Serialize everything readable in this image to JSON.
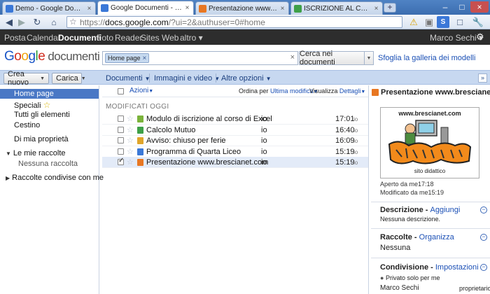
{
  "browser": {
    "tabs": [
      {
        "title": "Demo - Google Documenti",
        "favicon": "gdocs-icon",
        "active": false
      },
      {
        "title": "Google Documenti - Home ...",
        "favicon": "gdocs-icon",
        "active": true
      },
      {
        "title": "Presentazione www.bresci...",
        "favicon": "presentation-icon",
        "active": false
      },
      {
        "title": "ISCRIZIONE AL CORSO DI ...",
        "favicon": "spreadsheet-icon",
        "active": false
      }
    ],
    "url": "https://docs.google.com/?ui=2&authuser=0#home",
    "url_host": "docs.google.com",
    "url_path": "/?ui=2&authuser=0#home",
    "url_scheme": "https://"
  },
  "gbar": {
    "links": [
      "Posta",
      "Calendar",
      "Documenti",
      "Foto",
      "Reader",
      "Sites",
      "Web",
      "altro"
    ],
    "active": "Documenti",
    "more_suffix": " ▾",
    "user": "Marco Sechi",
    "user_suffix": " ▾"
  },
  "header": {
    "logo_product": "documenti",
    "search_chip": "Home page",
    "search_button": "Cerca nei documenti",
    "gallery_link": "Sfoglia la galleria dei modelli"
  },
  "actionbar": {
    "create_new": "Crea nuovo",
    "upload": "Carica",
    "menus": [
      "Documenti",
      "Immagini e video",
      "Altre opzioni"
    ]
  },
  "sidebar": {
    "items": [
      "Home page",
      "Speciali",
      "Tutti gli elementi",
      "Cestino",
      "Di mia proprietà"
    ],
    "collections_title": "Le mie raccolte",
    "collections_empty": "Nessuna raccolta",
    "shared_collections": "Raccolte condivise con me"
  },
  "list": {
    "actions": "Azioni",
    "sort_prefix": "Ordina per",
    "sort_value": "Ultima modifica",
    "view_prefix": "Visualizza",
    "view_value": "Dettagli",
    "section_title": "MODIFICATI OGGI",
    "rows": [
      {
        "name": "Modulo di iscrizione al corso di Excel",
        "owner": "io",
        "time": "17:01",
        "by": "io",
        "type": "form",
        "checked": false
      },
      {
        "name": "Calcolo Mutuo",
        "owner": "io",
        "time": "16:40",
        "by": "io",
        "type": "spreadsheet",
        "checked": false
      },
      {
        "name": "Avviso: chiuso per ferie",
        "owner": "io",
        "time": "16:09",
        "by": "io",
        "type": "document",
        "checked": false
      },
      {
        "name": "Programma di Quarta Liceo",
        "owner": "io",
        "time": "15:19",
        "by": "io",
        "type": "document-blue",
        "checked": false
      },
      {
        "name": "Presentazione www.brescianet.com",
        "owner": "io",
        "time": "15:19",
        "by": "io",
        "type": "presentation",
        "checked": true
      }
    ]
  },
  "preview": {
    "title": "Presentazione www.brescianet.c",
    "image_site": "www.brescianet.com",
    "image_logo_text": "Brescianet",
    "image_caption": "sito didattico",
    "opened": "Aperto da me17:18",
    "modified": "Modificato da me15:19",
    "description_title": "Descrizione",
    "description_link": "Aggiungi",
    "description_value": "Nessuna descrizione.",
    "collections_title": "Raccolte",
    "collections_link": "Organizza",
    "collections_value": "Nessuna",
    "sharing_title": "Condivisione",
    "sharing_link": "Impostazioni",
    "sharing_private": "Privato solo per me",
    "owner_name": "Marco Sechi",
    "owner_role": "proprietario"
  },
  "colors": {
    "accent": "#4a78c5",
    "actionbar_bg": "#c7d8f0",
    "gbar_bg": "#2d2d2d",
    "link": "#1a4fb5",
    "form_icon": "#7bb33b",
    "spreadsheet_icon": "#3ea048",
    "document_icon": "#e0a52a",
    "presentation_icon": "#e87722"
  }
}
